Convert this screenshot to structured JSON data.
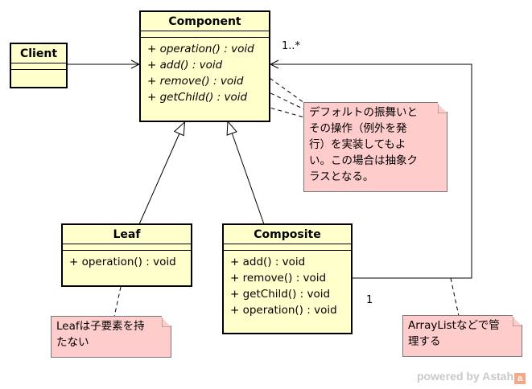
{
  "classes": {
    "client": {
      "name": "Client"
    },
    "component": {
      "name": "Component",
      "ops": [
        "+ operation() : void",
        "+ add() : void",
        "+ remove() : void",
        "+ getChild() : void"
      ]
    },
    "leaf": {
      "name": "Leaf",
      "ops": [
        "+ operation() : void"
      ]
    },
    "composite": {
      "name": "Composite",
      "ops": [
        "+ add() : void",
        "+ remove() : void",
        "+ getChild() : void",
        "+ operation() : void"
      ]
    }
  },
  "notes": {
    "default": [
      "デフォルトの振舞いと",
      "その操作（例外を発",
      "行）を実装してもよ",
      "い。この場合は抽象ク",
      "ラスとなる。"
    ],
    "leaf": [
      "Leafは子要素を持",
      "たない"
    ],
    "composite": [
      "ArrayListなどで管",
      "理する"
    ]
  },
  "multiplicity": {
    "many": "1..*",
    "one": "1"
  },
  "watermark": {
    "text": "powered by Astah",
    "logo": "a"
  },
  "colors": {
    "class_fill": "#ffffcc",
    "note_fill": "#ffcccc"
  }
}
